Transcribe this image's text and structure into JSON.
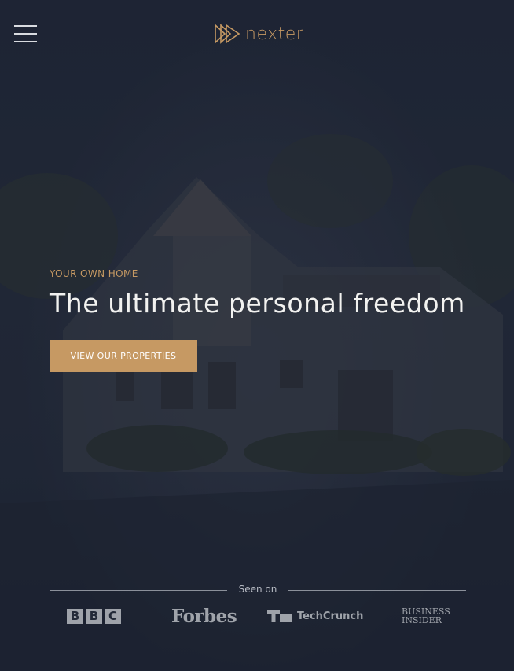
{
  "header": {
    "menu_icon": "hamburger-menu-icon",
    "logo_icon": "triple-play-triangle-icon",
    "logo_text": "nexter"
  },
  "hero": {
    "kicker": "YOUR OWN HOME",
    "headline": "The ultimate personal freedom",
    "cta_label": "VIEW OUR PROPERTIES"
  },
  "press": {
    "seen_on_label": "Seen on",
    "logos": {
      "bbc": [
        "B",
        "B",
        "C"
      ],
      "forbes": "Forbes",
      "techcrunch": "TechCrunch",
      "business_insider": [
        "BUSINESS",
        "INSIDER"
      ]
    }
  },
  "colors": {
    "accent": "#c69963",
    "overlay": "#1f2635",
    "text_light": "#f2f2f0",
    "logo_gray": "#9fa3aa"
  }
}
